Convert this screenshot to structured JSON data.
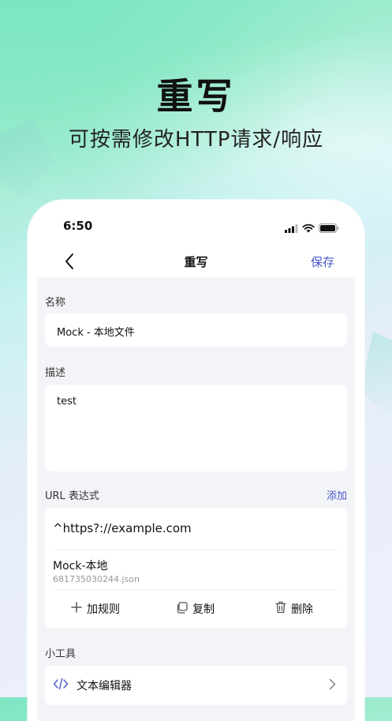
{
  "hero": {
    "title": "重写",
    "subtitle": "可按需修改HTTP请求/响应"
  },
  "status_bar": {
    "time": "6:50",
    "icons": [
      "signal-icon",
      "wifi-icon",
      "battery-icon"
    ]
  },
  "nav": {
    "back_icon": "chevron-left-icon",
    "title": "重写",
    "save_label": "保存"
  },
  "form": {
    "name_label": "名称",
    "name_value": "Mock - 本地文件",
    "desc_label": "描述",
    "desc_value": "test",
    "url_label": "URL 表达式",
    "url_add_label": "添加",
    "url_expression": "^https?://example.com",
    "rule": {
      "title": "Mock-本地",
      "file": "681735030244.json"
    },
    "actions": {
      "add_rule": "加规则",
      "copy": "复制",
      "delete": "删除"
    },
    "tools_label": "小工具",
    "tools": [
      {
        "icon": "code-icon",
        "label": "文本编辑器"
      }
    ]
  },
  "colors": {
    "accent": "#4a58c9",
    "page_bg": "#f3f4f7"
  }
}
